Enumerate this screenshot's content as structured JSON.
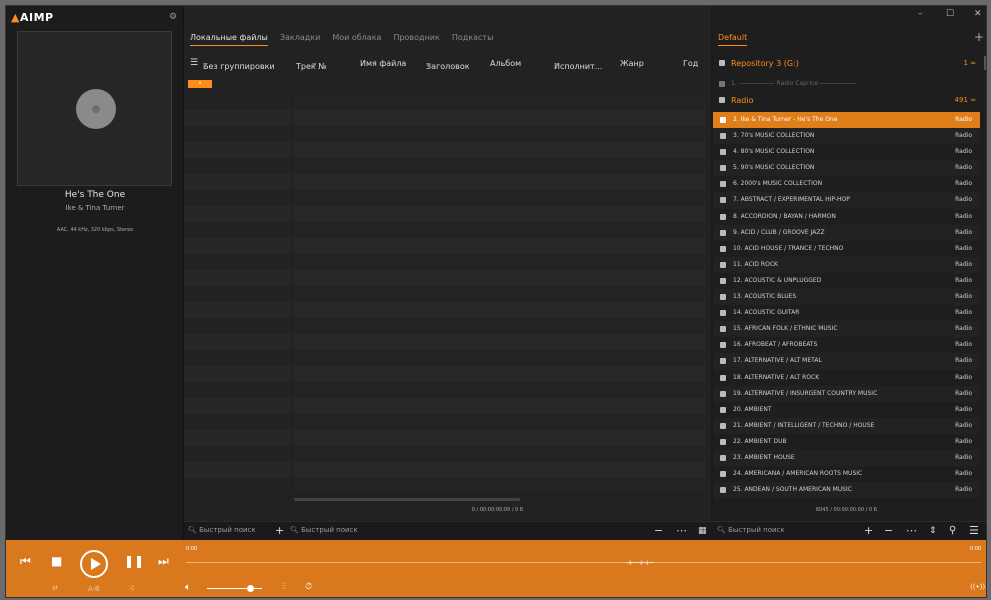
{
  "app": {
    "logo": "AIMP",
    "logo_tri": "▲"
  },
  "nowplaying": {
    "title": "He's The One",
    "artist": "Ike & Tina Turner",
    "info": "AAC, 44 kHz, 320 kbps, Stereo"
  },
  "center": {
    "tabs": [
      "Локальные файлы",
      "Закладки",
      "Мои облака",
      "Проводник",
      "Подкасты"
    ],
    "group_label": "Без группировки",
    "columns": [
      "Трек №",
      "Имя файла",
      "Заголовок",
      "Альбом",
      "Исполнит...",
      "Жанр",
      "Год"
    ],
    "group_badge": "•",
    "status": "0 / 00:00:00:00 / 0 Б"
  },
  "right": {
    "playlist_tab": "Default",
    "add_icon": "+",
    "window_controls": {
      "minimize": "–",
      "maximize": "☐",
      "close": "✕"
    },
    "groups": [
      {
        "name": "Repository 3 (G:)",
        "count": "1 ≈"
      },
      {
        "name": "Radio",
        "count": "491 ≈"
      }
    ],
    "sub_item": "1. ―――――― Radio Caprice ――――――",
    "items": [
      {
        "name": "2. Ike & Tina Turner - He's The One",
        "src": "Radio"
      },
      {
        "name": "3. 70's MUSIC COLLECTION",
        "src": "Radio"
      },
      {
        "name": "4. 80's MUSIC COLLECTION",
        "src": "Radio"
      },
      {
        "name": "5. 90's MUSIC COLLECTION",
        "src": "Radio"
      },
      {
        "name": "6. 2000's MUSIC COLLECTION",
        "src": "Radio"
      },
      {
        "name": "7. ABSTRACT / EXPERIMENTAL HIP-HOP",
        "src": "Radio"
      },
      {
        "name": "8. ACCORDION / BAYAN / HARMON",
        "src": "Radio"
      },
      {
        "name": "9. ACID / CLUB / GROOVE JAZZ",
        "src": "Radio"
      },
      {
        "name": "10. ACID HOUSE / TRANCE / TECHNO",
        "src": "Radio"
      },
      {
        "name": "11. ACID ROCK",
        "src": "Radio"
      },
      {
        "name": "12. ACOUSTIC & UNPLUGGED",
        "src": "Radio"
      },
      {
        "name": "13. ACOUSTIC BLUES",
        "src": "Radio"
      },
      {
        "name": "14. ACOUSTIC GUITAR",
        "src": "Radio"
      },
      {
        "name": "15. AFRICAN FOLK / ETHNIC MUSIC",
        "src": "Radio"
      },
      {
        "name": "16. AFROBEAT / AFROBEATS",
        "src": "Radio"
      },
      {
        "name": "17. ALTERNATIVE / ALT METAL",
        "src": "Radio"
      },
      {
        "name": "18. ALTERNATIVE / ALT ROCK",
        "src": "Radio"
      },
      {
        "name": "19. ALTERNATIVE / INSURGENT COUNTRY MUSIC",
        "src": "Radio"
      },
      {
        "name": "20. AMBIENT",
        "src": "Radio"
      },
      {
        "name": "21. AMBIENT / INTELLIGENT / TECHNO / HOUSE",
        "src": "Radio"
      },
      {
        "name": "22. AMBIENT DUB",
        "src": "Radio"
      },
      {
        "name": "23. AMBIENT HOUSE",
        "src": "Radio"
      },
      {
        "name": "24. AMERICANA / AMERICAN ROOTS MUSIC",
        "src": "Radio"
      },
      {
        "name": "25. ANDEAN / SOUTH AMERICAN MUSIC",
        "src": "Radio"
      }
    ],
    "status": "6045 / 00:00:00:00 / 0 Б"
  },
  "search": {
    "center_placeholder": "Быстрый поиск",
    "center_placeholder2": "Быстрый поиск",
    "right_placeholder": "Быстрый поиск"
  },
  "player": {
    "time_left": "0:00",
    "time_right": "0:00",
    "ab_label": "A-B",
    "volume": 0.78
  },
  "colors": {
    "accent": "#ff8c1a",
    "bottom_bar": "#d9781c"
  }
}
